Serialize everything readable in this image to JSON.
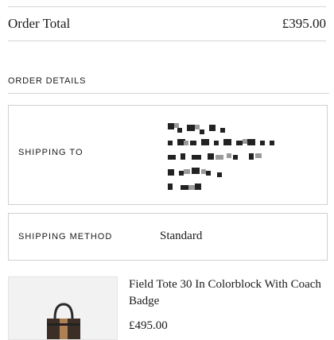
{
  "order_total": {
    "label": "Order Total",
    "value": "£395.00"
  },
  "order_details": {
    "title": "ORDER DETAILS",
    "shipping_to": {
      "label": "SHIPPING TO"
    },
    "shipping_method": {
      "label": "SHIPPING METHOD",
      "value": "Standard"
    }
  },
  "product": {
    "name": "Field Tote 30 In Colorblock With Coach Badge",
    "price": "£495.00",
    "icon": "tote-bag-image"
  }
}
